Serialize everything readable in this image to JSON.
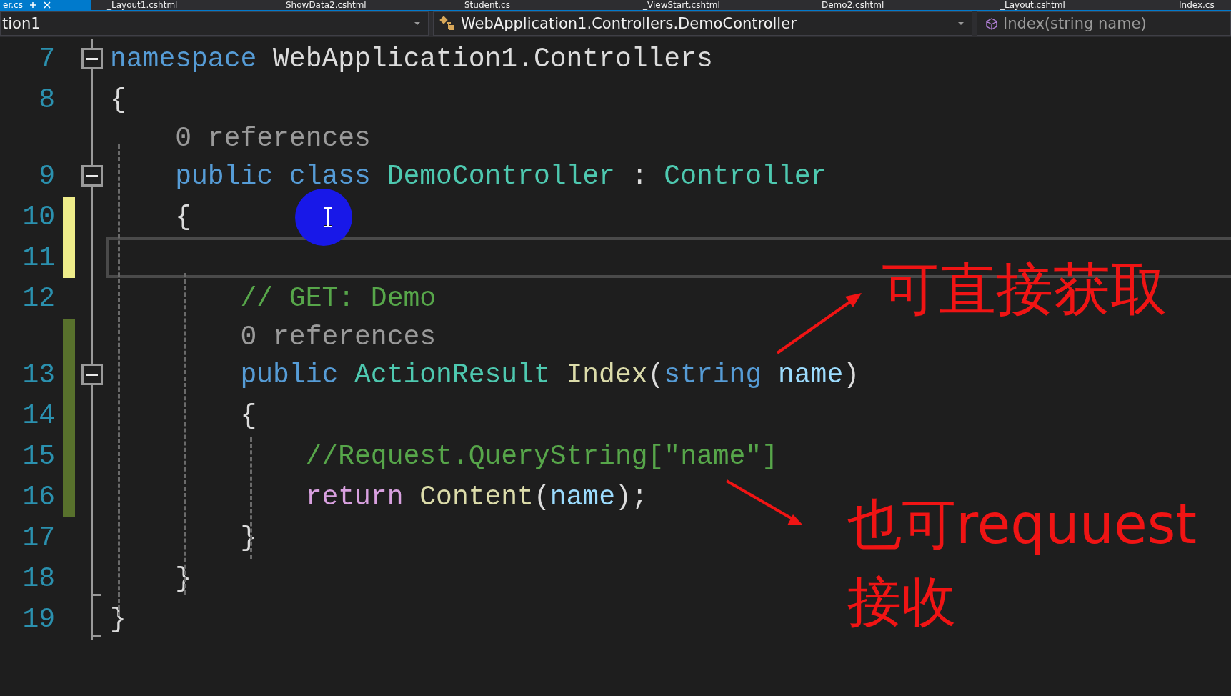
{
  "tabs": [
    {
      "label": "er.cs",
      "selected": true
    },
    {
      "label": "_Layout1.cshtml",
      "selected": false
    },
    {
      "label": "ShowData2.cshtml",
      "selected": false
    },
    {
      "label": "Student.cs",
      "selected": false
    },
    {
      "label": "_ViewStart.cshtml",
      "selected": false
    },
    {
      "label": "Demo2.cshtml",
      "selected": false
    },
    {
      "label": "_Layout.cshtml",
      "selected": false
    },
    {
      "label": "Index.cs",
      "selected": false
    }
  ],
  "navigation_bar": {
    "project": "tion1",
    "type": "WebApplication1.Controllers.DemoController",
    "member": "Index(string name)"
  },
  "lines": [
    {
      "kind": "code",
      "number": "7",
      "fold": true,
      "tokens": [
        {
          "kind": "keyword",
          "text": "namespace "
        },
        {
          "kind": "plain",
          "text": "WebApplication1.Controllers"
        }
      ]
    },
    {
      "kind": "code",
      "number": "8",
      "tokens": [
        {
          "kind": "plain",
          "text": "{"
        }
      ],
      "children": [
        {
          "kind": "codelens",
          "text": "0 references"
        },
        {
          "kind": "code",
          "number": "9",
          "fold": true,
          "tokens": [
            {
              "kind": "keyword",
              "text": "public class "
            },
            {
              "kind": "type",
              "text": "DemoController"
            },
            {
              "kind": "plain",
              "text": " : "
            },
            {
              "kind": "type",
              "text": "Controller"
            }
          ]
        },
        {
          "kind": "code",
          "number": "10",
          "changed": true,
          "saved": false,
          "tokens": [
            {
              "kind": "plain",
              "text": "{"
            }
          ],
          "children": [
            {
              "kind": "code",
              "number": "11",
              "changed": true,
              "saved": false,
              "current": true
            },
            {
              "kind": "code",
              "number": "12",
              "tokens": [
                {
                  "kind": "comment",
                  "text": "// GET: Demo"
                }
              ]
            },
            {
              "kind": "codelens",
              "changed": true,
              "saved": true,
              "text": "0 references"
            },
            {
              "kind": "code",
              "number": "13",
              "fold": true,
              "changed": true,
              "saved": true,
              "tokens": [
                {
                  "kind": "keyword",
                  "text": "public "
                },
                {
                  "kind": "type",
                  "text": "ActionResult "
                },
                {
                  "kind": "method",
                  "text": "Index"
                },
                {
                  "kind": "plain",
                  "text": "("
                },
                {
                  "kind": "keyword",
                  "text": "string "
                },
                {
                  "kind": "param",
                  "text": "name"
                },
                {
                  "kind": "plain",
                  "text": ")"
                }
              ]
            },
            {
              "kind": "code",
              "number": "14",
              "changed": true,
              "saved": true,
              "tokens": [
                {
                  "kind": "plain",
                  "text": "{"
                }
              ],
              "children": [
                {
                  "kind": "code",
                  "number": "15",
                  "changed": true,
                  "saved": true,
                  "tokens": [
                    {
                      "kind": "comment",
                      "text": "//Request.QueryString[\"name\"]"
                    }
                  ]
                },
                {
                  "kind": "code",
                  "number": "16",
                  "changed": true,
                  "saved": true,
                  "tokens": [
                    {
                      "kind": "control",
                      "text": "return "
                    },
                    {
                      "kind": "method",
                      "text": "Content"
                    },
                    {
                      "kind": "plain",
                      "text": "("
                    },
                    {
                      "kind": "param",
                      "text": "name"
                    },
                    {
                      "kind": "plain",
                      "text": ");"
                    }
                  ]
                }
              ]
            },
            {
              "kind": "code",
              "number": "17",
              "tokens": [
                {
                  "kind": "plain",
                  "text": "}"
                }
              ]
            }
          ]
        },
        {
          "kind": "code",
          "number": "18",
          "block_end": true,
          "tokens": [
            {
              "kind": "plain",
              "text": "}"
            }
          ]
        }
      ]
    },
    {
      "kind": "code",
      "number": "19",
      "block_end": true,
      "tokens": [
        {
          "kind": "plain",
          "text": "}"
        }
      ]
    }
  ],
  "annotations": [
    {
      "text": "可直接获取"
    },
    {
      "text": "也可requuest\n接收"
    }
  ]
}
